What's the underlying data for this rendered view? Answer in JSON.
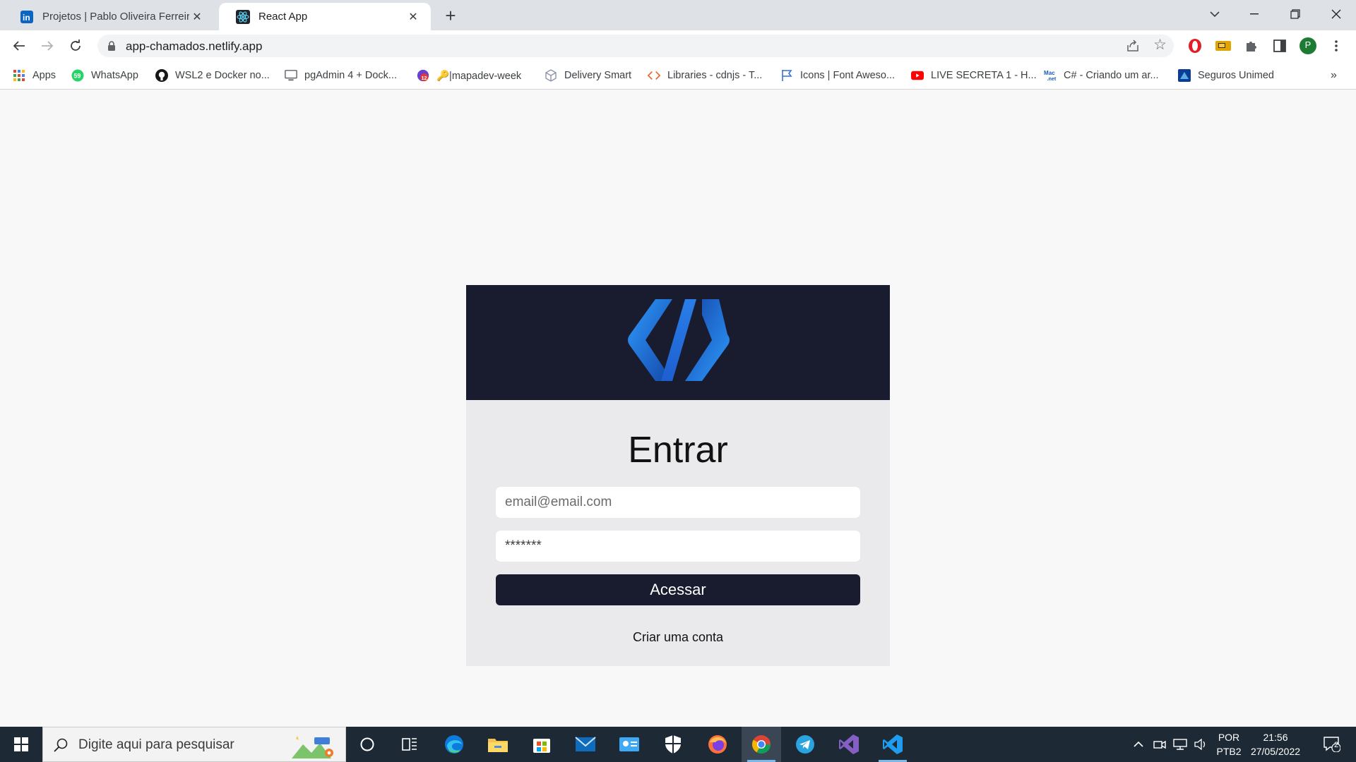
{
  "browser": {
    "tabs": [
      {
        "title": "Projetos | Pablo Oliveira Ferreira |",
        "icon": "linkedin-icon",
        "active": false
      },
      {
        "title": "React App",
        "icon": "react-icon",
        "active": true
      }
    ],
    "close_glyph": "✕",
    "new_tab_glyph": "+",
    "url": "app-chamados.netlify.app",
    "profile_initial": "P",
    "bookmarks": [
      {
        "label": "Apps",
        "icon": "apps-grid-icon"
      },
      {
        "label": "WhatsApp",
        "icon": "whatsapp-icon"
      },
      {
        "label": "WSL2 e Docker no...",
        "icon": "github-icon"
      },
      {
        "label": "pgAdmin 4 + Dock...",
        "icon": "monitor-icon"
      },
      {
        "label": "🔑|mapadev-week",
        "icon": "badge-12-icon"
      },
      {
        "label": "Delivery Smart",
        "icon": "cube-icon"
      },
      {
        "label": "Libraries - cdnjs - T...",
        "icon": "code-brackets-icon"
      },
      {
        "label": "Icons | Font Aweso...",
        "icon": "flag-icon"
      },
      {
        "label": "LIVE SECRETA 1 - H...",
        "icon": "youtube-icon"
      },
      {
        "label": "C# - Criando um ar...",
        "icon": "macoratti-icon"
      },
      {
        "label": "Seguros Unimed",
        "icon": "unimed-icon"
      }
    ],
    "more_bookmarks_glyph": "»"
  },
  "login": {
    "title": "Entrar",
    "email_placeholder": "email@email.com",
    "password_value": "*******",
    "submit_label": "Acessar",
    "signup_link": "Criar uma conta"
  },
  "taskbar": {
    "search_placeholder": "Digite aqui para pesquisar",
    "language": "POR",
    "layout": "PTB2",
    "time": "21:56",
    "date": "27/05/2022",
    "notification_count": "2"
  },
  "colors": {
    "header": "#181c2e",
    "button": "#181c2e",
    "card": "#eaeaec",
    "logo_light": "#2f9bff",
    "logo_dark": "#1446a8"
  }
}
